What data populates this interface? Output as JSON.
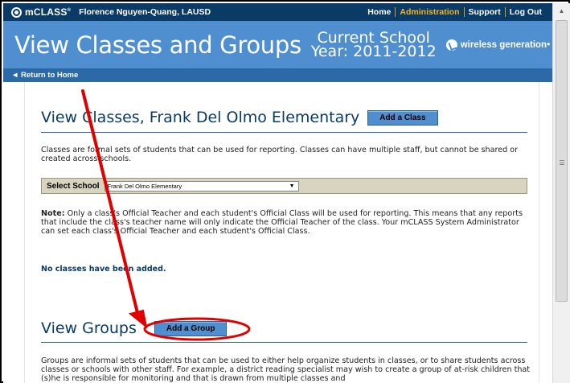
{
  "topbar": {
    "logo_text": "mCLASS",
    "logo_mark": "®",
    "user": "Florence Nguyen-Quang, LAUSD",
    "nav": [
      {
        "label": "Home",
        "active": false
      },
      {
        "label": "Administration",
        "active": true
      },
      {
        "label": "Support",
        "active": false
      },
      {
        "label": "Log Out",
        "active": false
      }
    ]
  },
  "header": {
    "title": "View Classes and Groups",
    "year_line1": "Current School",
    "year_line2": "Year: 2011-2012",
    "brand": "wireless generation",
    "brand_mark": "•"
  },
  "subbar": {
    "back_link": "◄ Return to Home"
  },
  "classes": {
    "title": "View Classes, Frank Del Olmo Elementary",
    "add_button": "Add a Class",
    "description": "Classes are formal sets of students that can be used for reporting. Classes can have multiple staff, but cannot be shared or created across schools.",
    "select_label": "Select School",
    "select_value": "Frank Del Olmo Elementary",
    "note_label": "Note:",
    "note_text": " Only a class's Official Teacher and each student's Official Class will be used for reporting. This means that any reports that include the class's teacher name will only indicate the Official Teacher of the class. Your mCLASS System Administrator can set each class's Official Teacher and each student's Official Class.",
    "empty_message": "No classes have been added."
  },
  "groups": {
    "title": "View Groups",
    "add_button": "Add a Group",
    "description": "Groups are informal sets of students that can be used to either help organize students in classes, or to share students across classes or schools with other staff. For example, a district reading specialist may wish to create a group of at-risk children that (s)he is responsible for monitoring and that is drawn from multiple classes and"
  },
  "icons": {
    "scroll_up": "scroll-up-arrow-icon",
    "caret": "dropdown-caret-icon"
  },
  "colors": {
    "topbar": "#0a3a66",
    "header": "#4f8fcf",
    "subbar": "#2b6aa6",
    "active_nav": "#f6b323",
    "annotation": "#e00000"
  }
}
